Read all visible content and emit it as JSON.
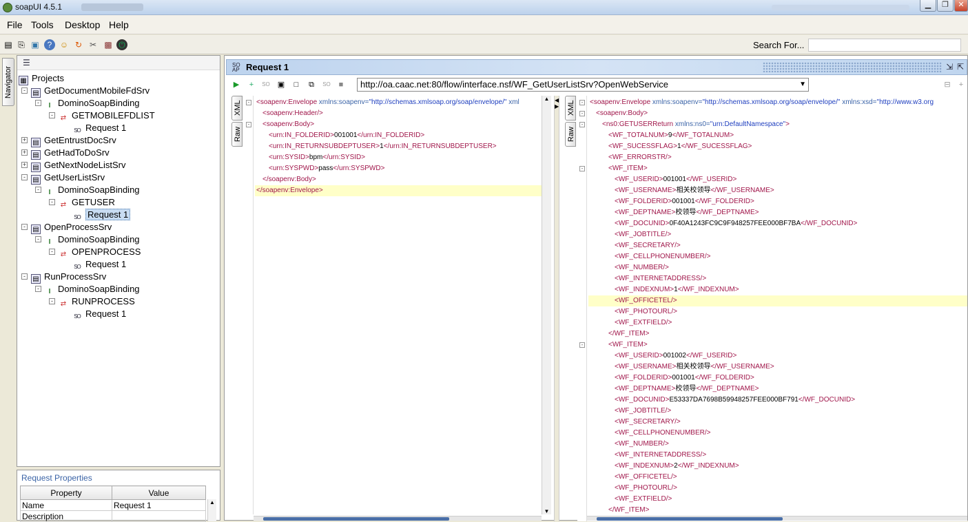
{
  "window": {
    "title": "soapUI 4.5.1"
  },
  "menu": {
    "items": [
      "File",
      "Tools",
      "Desktop",
      "Help"
    ]
  },
  "toolbar": {
    "search_label": "Search For...",
    "search_value": ""
  },
  "navigator": {
    "tab_label": "Navigator",
    "root": "Projects",
    "nodes": [
      {
        "label": "GetDocumentMobileFdSrv",
        "level": 1,
        "type": "project",
        "toggle": "−"
      },
      {
        "label": "DominoSoapBinding",
        "level": 2,
        "type": "interface",
        "toggle": "−"
      },
      {
        "label": "GETMOBILEFDLIST",
        "level": 3,
        "type": "operation",
        "toggle": "−"
      },
      {
        "label": "Request 1",
        "level": 4,
        "type": "request"
      },
      {
        "label": "GetEntrustDocSrv",
        "level": 1,
        "type": "project",
        "toggle": "+"
      },
      {
        "label": "GetHadToDoSrv",
        "level": 1,
        "type": "project",
        "toggle": "+"
      },
      {
        "label": "GetNextNodeListSrv",
        "level": 1,
        "type": "project",
        "toggle": "+"
      },
      {
        "label": "GetUserListSrv",
        "level": 1,
        "type": "project",
        "toggle": "−"
      },
      {
        "label": "DominoSoapBinding",
        "level": 2,
        "type": "interface",
        "toggle": "−"
      },
      {
        "label": "GETUSER",
        "level": 3,
        "type": "operation",
        "toggle": "−"
      },
      {
        "label": "Request 1",
        "level": 4,
        "type": "request",
        "selected": true
      },
      {
        "label": "OpenProcessSrv",
        "level": 1,
        "type": "project",
        "toggle": "−"
      },
      {
        "label": "DominoSoapBinding",
        "level": 2,
        "type": "interface",
        "toggle": "−"
      },
      {
        "label": "OPENPROCESS",
        "level": 3,
        "type": "operation",
        "toggle": "−"
      },
      {
        "label": "Request 1",
        "level": 4,
        "type": "request"
      },
      {
        "label": "RunProcessSrv",
        "level": 1,
        "type": "project",
        "toggle": "−"
      },
      {
        "label": "DominoSoapBinding",
        "level": 2,
        "type": "interface",
        "toggle": "−"
      },
      {
        "label": "RUNPROCESS",
        "level": 3,
        "type": "operation",
        "toggle": "−"
      },
      {
        "label": "Request 1",
        "level": 4,
        "type": "request"
      }
    ]
  },
  "request_properties": {
    "title": "Request Properties",
    "columns": [
      "Property",
      "Value"
    ],
    "rows": [
      [
        "Name",
        "Request 1"
      ],
      [
        "Description",
        ""
      ]
    ]
  },
  "request": {
    "title": "Request 1",
    "endpoint": "http://oa.caac.net:80/flow/interface.nsf/WF_GetUserListSrv?OpenWebService",
    "tab_xml": "XML",
    "tab_raw": "Raw"
  },
  "request_xml": [
    {
      "i": 0,
      "fold": "−",
      "parts": [
        [
          "t",
          "<soapenv:Envelope "
        ],
        [
          "a",
          "xmlns:soapenv="
        ],
        [
          "v",
          "\"http://schemas.xmlsoap.org/soap/envelope/\""
        ],
        [
          "a",
          " xml"
        ]
      ]
    },
    {
      "i": 1,
      "parts": [
        [
          "t",
          "<soapenv:Header/>"
        ]
      ]
    },
    {
      "i": 1,
      "fold": "−",
      "parts": [
        [
          "t",
          "<soapenv:Body>"
        ]
      ]
    },
    {
      "i": 2,
      "parts": [
        [
          "t",
          "<urn:IN_FOLDERID>"
        ],
        [
          "x",
          "001001"
        ],
        [
          "t",
          "</urn:IN_FOLDERID>"
        ]
      ]
    },
    {
      "i": 2,
      "parts": [
        [
          "t",
          "<urn:IN_RETURNSUBDEPTUSER>"
        ],
        [
          "x",
          "1"
        ],
        [
          "t",
          "</urn:IN_RETURNSUBDEPTUSER>"
        ]
      ]
    },
    {
      "i": 2,
      "parts": [
        [
          "t",
          "<urn:SYSID>"
        ],
        [
          "x",
          "bpm"
        ],
        [
          "t",
          "</urn:SYSID>"
        ]
      ]
    },
    {
      "i": 2,
      "parts": [
        [
          "t",
          "<urn:SYSPWD>"
        ],
        [
          "x",
          "pass"
        ],
        [
          "t",
          "</urn:SYSPWD>"
        ]
      ]
    },
    {
      "i": 1,
      "parts": [
        [
          "t",
          "</soapenv:Body>"
        ]
      ]
    },
    {
      "i": 0,
      "hl": true,
      "parts": [
        [
          "t",
          "</soapenv:Envelope>"
        ]
      ]
    }
  ],
  "response_xml": [
    {
      "i": 0,
      "fold": "−",
      "parts": [
        [
          "t",
          "<soapenv:Envelope "
        ],
        [
          "a",
          "xmlns:soapenv="
        ],
        [
          "v",
          "\"http://schemas.xmlsoap.org/soap/envelope/\""
        ],
        [
          "a",
          " xmlns:xsd="
        ],
        [
          "v",
          "\"http://www.w3.org"
        ]
      ]
    },
    {
      "i": 1,
      "fold": "−",
      "parts": [
        [
          "t",
          "<soapenv:Body>"
        ]
      ]
    },
    {
      "i": 2,
      "fold": "−",
      "parts": [
        [
          "t",
          "<ns0:GETUSERReturn "
        ],
        [
          "a",
          "xmlns:ns0="
        ],
        [
          "v",
          "\"urn:DefaultNamespace\""
        ],
        [
          "t",
          ">"
        ]
      ]
    },
    {
      "i": 3,
      "parts": [
        [
          "t",
          "<WF_TOTALNUM>"
        ],
        [
          "x",
          "9"
        ],
        [
          "t",
          "</WF_TOTALNUM>"
        ]
      ]
    },
    {
      "i": 3,
      "parts": [
        [
          "t",
          "<WF_SUCESSFLAG>"
        ],
        [
          "x",
          "1"
        ],
        [
          "t",
          "</WF_SUCESSFLAG>"
        ]
      ]
    },
    {
      "i": 3,
      "parts": [
        [
          "t",
          "<WF_ERRORSTR/>"
        ]
      ]
    },
    {
      "i": 3,
      "fold": "−",
      "parts": [
        [
          "t",
          "<WF_ITEM>"
        ]
      ]
    },
    {
      "i": 4,
      "parts": [
        [
          "t",
          "<WF_USERID>"
        ],
        [
          "x",
          "001001"
        ],
        [
          "t",
          "</WF_USERID>"
        ]
      ]
    },
    {
      "i": 4,
      "parts": [
        [
          "t",
          "<WF_USERNAME>"
        ],
        [
          "x",
          "相关校领导"
        ],
        [
          "t",
          "</WF_USERNAME>"
        ]
      ]
    },
    {
      "i": 4,
      "parts": [
        [
          "t",
          "<WF_FOLDERID>"
        ],
        [
          "x",
          "001001"
        ],
        [
          "t",
          "</WF_FOLDERID>"
        ]
      ]
    },
    {
      "i": 4,
      "parts": [
        [
          "t",
          "<WF_DEPTNAME>"
        ],
        [
          "x",
          "校领导"
        ],
        [
          "t",
          "</WF_DEPTNAME>"
        ]
      ]
    },
    {
      "i": 4,
      "parts": [
        [
          "t",
          "<WF_DOCUNID>"
        ],
        [
          "x",
          "0F40A1243FC9C9F948257FEE000BF7BA"
        ],
        [
          "t",
          "</WF_DOCUNID>"
        ]
      ]
    },
    {
      "i": 4,
      "parts": [
        [
          "t",
          "<WF_JOBTITLE/>"
        ]
      ]
    },
    {
      "i": 4,
      "parts": [
        [
          "t",
          "<WF_SECRETARY/>"
        ]
      ]
    },
    {
      "i": 4,
      "parts": [
        [
          "t",
          "<WF_CELLPHONENUMBER/>"
        ]
      ]
    },
    {
      "i": 4,
      "parts": [
        [
          "t",
          "<WF_NUMBER/>"
        ]
      ]
    },
    {
      "i": 4,
      "parts": [
        [
          "t",
          "<WF_INTERNETADDRESS/>"
        ]
      ]
    },
    {
      "i": 4,
      "parts": [
        [
          "t",
          "<WF_INDEXNUM>"
        ],
        [
          "x",
          "1"
        ],
        [
          "t",
          "</WF_INDEXNUM>"
        ]
      ]
    },
    {
      "i": 4,
      "hl": true,
      "parts": [
        [
          "t",
          "<WF_OFFICETEL/>"
        ]
      ]
    },
    {
      "i": 4,
      "parts": [
        [
          "t",
          "<WF_PHOTOURL/>"
        ]
      ]
    },
    {
      "i": 4,
      "parts": [
        [
          "t",
          "<WF_EXTFIELD/>"
        ]
      ]
    },
    {
      "i": 3,
      "parts": [
        [
          "t",
          "</WF_ITEM>"
        ]
      ]
    },
    {
      "i": 3,
      "fold": "−",
      "parts": [
        [
          "t",
          "<WF_ITEM>"
        ]
      ]
    },
    {
      "i": 4,
      "parts": [
        [
          "t",
          "<WF_USERID>"
        ],
        [
          "x",
          "001002"
        ],
        [
          "t",
          "</WF_USERID>"
        ]
      ]
    },
    {
      "i": 4,
      "parts": [
        [
          "t",
          "<WF_USERNAME>"
        ],
        [
          "x",
          "相关校领导"
        ],
        [
          "t",
          "</WF_USERNAME>"
        ]
      ]
    },
    {
      "i": 4,
      "parts": [
        [
          "t",
          "<WF_FOLDERID>"
        ],
        [
          "x",
          "001001"
        ],
        [
          "t",
          "</WF_FOLDERID>"
        ]
      ]
    },
    {
      "i": 4,
      "parts": [
        [
          "t",
          "<WF_DEPTNAME>"
        ],
        [
          "x",
          "校领导"
        ],
        [
          "t",
          "</WF_DEPTNAME>"
        ]
      ]
    },
    {
      "i": 4,
      "parts": [
        [
          "t",
          "<WF_DOCUNID>"
        ],
        [
          "x",
          "E53337DA7698B59948257FEE000BF791"
        ],
        [
          "t",
          "</WF_DOCUNID>"
        ]
      ]
    },
    {
      "i": 4,
      "parts": [
        [
          "t",
          "<WF_JOBTITLE/>"
        ]
      ]
    },
    {
      "i": 4,
      "parts": [
        [
          "t",
          "<WF_SECRETARY/>"
        ]
      ]
    },
    {
      "i": 4,
      "parts": [
        [
          "t",
          "<WF_CELLPHONENUMBER/>"
        ]
      ]
    },
    {
      "i": 4,
      "parts": [
        [
          "t",
          "<WF_NUMBER/>"
        ]
      ]
    },
    {
      "i": 4,
      "parts": [
        [
          "t",
          "<WF_INTERNETADDRESS/>"
        ]
      ]
    },
    {
      "i": 4,
      "parts": [
        [
          "t",
          "<WF_INDEXNUM>"
        ],
        [
          "x",
          "2"
        ],
        [
          "t",
          "</WF_INDEXNUM>"
        ]
      ]
    },
    {
      "i": 4,
      "parts": [
        [
          "t",
          "<WF_OFFICETEL/>"
        ]
      ]
    },
    {
      "i": 4,
      "parts": [
        [
          "t",
          "<WF_PHOTOURL/>"
        ]
      ]
    },
    {
      "i": 4,
      "parts": [
        [
          "t",
          "<WF_EXTFIELD/>"
        ]
      ]
    },
    {
      "i": 3,
      "parts": [
        [
          "t",
          "</WF_ITEM>"
        ]
      ]
    }
  ]
}
